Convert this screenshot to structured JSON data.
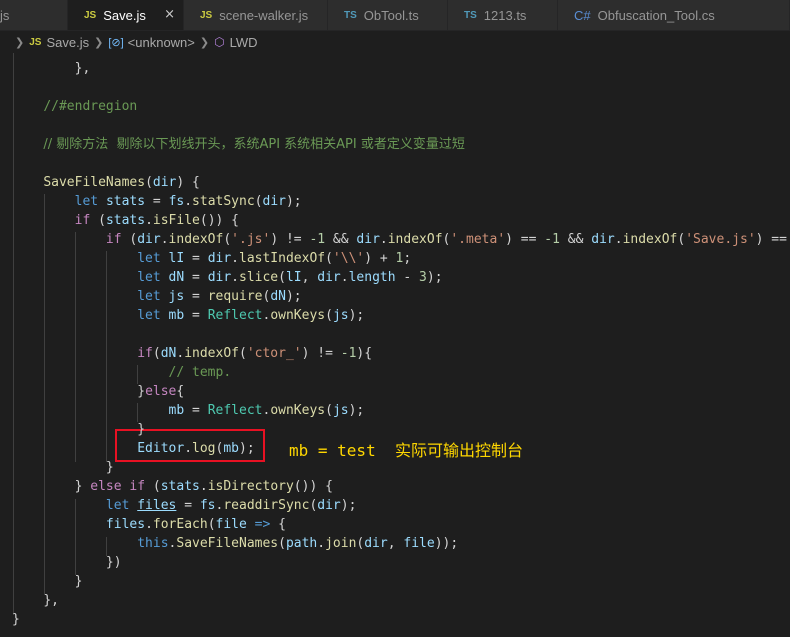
{
  "tabs": [
    {
      "badge": "",
      "name": "js",
      "active": false,
      "close": ""
    },
    {
      "badge": "JS",
      "name": "Save.js",
      "active": true,
      "close": "×"
    },
    {
      "badge": "JS",
      "name": "scene-walker.js",
      "active": false,
      "close": ""
    },
    {
      "badge": "TS",
      "name": "ObTool.ts",
      "active": false,
      "close": ""
    },
    {
      "badge": "TS",
      "name": "1213.ts",
      "active": false,
      "close": ""
    },
    {
      "badge": "C#",
      "name": "Obfuscation_Tool.cs",
      "active": false,
      "close": ""
    }
  ],
  "breadcrumb": {
    "file_badge": "JS",
    "file": "Save.js",
    "symbol_icon": "[⊘]",
    "symbol": "<unknown>",
    "method": "LWD"
  },
  "code_lines": [
    {
      "n": 0,
      "t": [
        [
          "        "
        ],
        [
          "},",
          "p"
        ]
      ]
    },
    {
      "n": 1,
      "t": []
    },
    {
      "n": 2,
      "t": [
        [
          "    "
        ],
        [
          "//#endregion",
          "cmt"
        ]
      ]
    },
    {
      "n": 3,
      "t": []
    },
    {
      "n": 4,
      "t": [
        [
          "    "
        ],
        [
          "// 剔除方法  剔除以下划线开头，系统API 系统相关API 或者定义变量过短",
          "cmt"
        ]
      ]
    },
    {
      "n": 5,
      "t": []
    },
    {
      "n": 6,
      "t": [
        [
          "    "
        ],
        [
          "SaveFileNames",
          "fn"
        ],
        [
          "("
        ],
        [
          "dir",
          "var"
        ],
        [
          ") {"
        ]
      ]
    },
    {
      "n": 7,
      "t": [
        [
          "        "
        ],
        [
          "let",
          "kw"
        ],
        [
          " "
        ],
        [
          "stats",
          "var"
        ],
        [
          " = "
        ],
        [
          "fs",
          "var"
        ],
        [
          "."
        ],
        [
          "statSync",
          "fn"
        ],
        [
          "("
        ],
        [
          "dir",
          "var"
        ],
        [
          ");"
        ]
      ]
    },
    {
      "n": 8,
      "t": [
        [
          "        "
        ],
        [
          "if",
          "ctl"
        ],
        [
          " ("
        ],
        [
          "stats",
          "var"
        ],
        [
          "."
        ],
        [
          "isFile",
          "fn"
        ],
        [
          "()) {"
        ]
      ]
    },
    {
      "n": 9,
      "t": [
        [
          "            "
        ],
        [
          "if",
          "ctl"
        ],
        [
          " ("
        ],
        [
          "dir",
          "var"
        ],
        [
          "."
        ],
        [
          "indexOf",
          "fn"
        ],
        [
          "("
        ],
        [
          "'.js'",
          "str"
        ],
        [
          ") != "
        ],
        [
          "-1",
          "num"
        ],
        [
          " && "
        ],
        [
          "dir",
          "var"
        ],
        [
          "."
        ],
        [
          "indexOf",
          "fn"
        ],
        [
          "("
        ],
        [
          "'.meta'",
          "str"
        ],
        [
          ") == "
        ],
        [
          "-1",
          "num"
        ],
        [
          " && "
        ],
        [
          "dir",
          "var"
        ],
        [
          "."
        ],
        [
          "indexOf",
          "fn"
        ],
        [
          "("
        ],
        [
          "'Save.js'",
          "str"
        ],
        [
          ") == -"
        ]
      ]
    },
    {
      "n": 10,
      "t": [
        [
          "                "
        ],
        [
          "let",
          "kw"
        ],
        [
          " "
        ],
        [
          "lI",
          "var"
        ],
        [
          " = "
        ],
        [
          "dir",
          "var"
        ],
        [
          "."
        ],
        [
          "lastIndexOf",
          "fn"
        ],
        [
          "("
        ],
        [
          "'\\\\'",
          "str"
        ],
        [
          ") + "
        ],
        [
          "1",
          "num"
        ],
        [
          ";"
        ]
      ]
    },
    {
      "n": 11,
      "t": [
        [
          "                "
        ],
        [
          "let",
          "kw"
        ],
        [
          " "
        ],
        [
          "dN",
          "var"
        ],
        [
          " = "
        ],
        [
          "dir",
          "var"
        ],
        [
          "."
        ],
        [
          "slice",
          "fn"
        ],
        [
          "("
        ],
        [
          "lI",
          "var"
        ],
        [
          ", "
        ],
        [
          "dir",
          "var"
        ],
        [
          "."
        ],
        [
          "length",
          "var"
        ],
        [
          " - "
        ],
        [
          "3",
          "num"
        ],
        [
          ");"
        ]
      ]
    },
    {
      "n": 12,
      "t": [
        [
          "                "
        ],
        [
          "let",
          "kw"
        ],
        [
          " "
        ],
        [
          "js",
          "var"
        ],
        [
          " = "
        ],
        [
          "require",
          "fn"
        ],
        [
          "("
        ],
        [
          "dN",
          "var"
        ],
        [
          ");"
        ]
      ]
    },
    {
      "n": 13,
      "t": [
        [
          "                "
        ],
        [
          "let",
          "kw"
        ],
        [
          " "
        ],
        [
          "mb",
          "var"
        ],
        [
          " = "
        ],
        [
          "Reflect",
          "cls"
        ],
        [
          "."
        ],
        [
          "ownKeys",
          "fn"
        ],
        [
          "("
        ],
        [
          "js",
          "var"
        ],
        [
          ");"
        ]
      ]
    },
    {
      "n": 14,
      "t": []
    },
    {
      "n": 15,
      "t": [
        [
          "                "
        ],
        [
          "if",
          "ctl"
        ],
        [
          "("
        ],
        [
          "dN",
          "var"
        ],
        [
          "."
        ],
        [
          "indexOf",
          "fn"
        ],
        [
          "("
        ],
        [
          "'ctor_'",
          "str"
        ],
        [
          ") != "
        ],
        [
          "-1",
          "num"
        ],
        [
          "){"
        ]
      ]
    },
    {
      "n": 16,
      "t": [
        [
          "                    "
        ],
        [
          "// temp.",
          "cmt"
        ]
      ]
    },
    {
      "n": 17,
      "t": [
        [
          "                "
        ],
        [
          "}"
        ],
        [
          "else",
          "ctl"
        ],
        [
          "{"
        ]
      ]
    },
    {
      "n": 18,
      "t": [
        [
          "                    "
        ],
        [
          "mb",
          "var"
        ],
        [
          " = "
        ],
        [
          "Reflect",
          "cls"
        ],
        [
          "."
        ],
        [
          "ownKeys",
          "fn"
        ],
        [
          "("
        ],
        [
          "js",
          "var"
        ],
        [
          ");"
        ]
      ]
    },
    {
      "n": 19,
      "t": [
        [
          "                "
        ],
        [
          "}"
        ]
      ]
    },
    {
      "n": 20,
      "t": [
        [
          "                "
        ],
        [
          "Editor",
          "var"
        ],
        [
          "."
        ],
        [
          "log",
          "fn"
        ],
        [
          "("
        ],
        [
          "mb",
          "var"
        ],
        [
          ");"
        ]
      ]
    },
    {
      "n": 21,
      "t": [
        [
          "            "
        ],
        [
          "}"
        ]
      ]
    },
    {
      "n": 22,
      "t": [
        [
          "        "
        ],
        [
          "} "
        ],
        [
          "else",
          "ctl"
        ],
        [
          " "
        ],
        [
          "if",
          "ctl"
        ],
        [
          " ("
        ],
        [
          "stats",
          "var"
        ],
        [
          "."
        ],
        [
          "isDirectory",
          "fn"
        ],
        [
          "()) {"
        ]
      ]
    },
    {
      "n": 23,
      "t": [
        [
          "            "
        ],
        [
          "let",
          "kw"
        ],
        [
          " "
        ],
        [
          "files",
          "var ul"
        ],
        [
          " = "
        ],
        [
          "fs",
          "var"
        ],
        [
          "."
        ],
        [
          "readdirSync",
          "fn"
        ],
        [
          "("
        ],
        [
          "dir",
          "var"
        ],
        [
          ");"
        ]
      ]
    },
    {
      "n": 24,
      "t": [
        [
          "            "
        ],
        [
          "files",
          "var"
        ],
        [
          "."
        ],
        [
          "forEach",
          "fn"
        ],
        [
          "("
        ],
        [
          "file",
          "var"
        ],
        [
          " "
        ],
        [
          "=>",
          "kw"
        ],
        [
          " {"
        ]
      ]
    },
    {
      "n": 25,
      "t": [
        [
          "                "
        ],
        [
          "this",
          "kw"
        ],
        [
          "."
        ],
        [
          "SaveFileNames",
          "fn"
        ],
        [
          "("
        ],
        [
          "path",
          "var"
        ],
        [
          "."
        ],
        [
          "join",
          "fn"
        ],
        [
          "("
        ],
        [
          "dir",
          "var"
        ],
        [
          ", "
        ],
        [
          "file",
          "var"
        ],
        [
          "));"
        ]
      ]
    },
    {
      "n": 26,
      "t": [
        [
          "            "
        ],
        [
          "})"
        ]
      ]
    },
    {
      "n": 27,
      "t": [
        [
          "        "
        ],
        [
          "}"
        ]
      ]
    },
    {
      "n": 28,
      "t": [
        [
          "    "
        ],
        [
          "},"
        ]
      ]
    },
    {
      "n": 29,
      "t": [
        [
          "}"
        ]
      ]
    }
  ],
  "annotation": {
    "code": "mb = test  ",
    "text": "实际可输出控制台"
  },
  "colors": {
    "background": "#1e1e1e",
    "tabbar": "#252526",
    "highlight_box": "#e81123",
    "annotation": "#ffd700"
  }
}
